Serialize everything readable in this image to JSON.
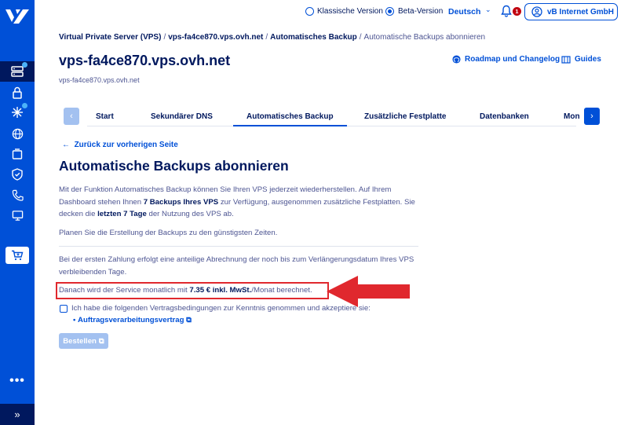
{
  "topbar": {
    "classic_version": "Klassische Version",
    "beta_version": "Beta-Version",
    "language": "Deutsch",
    "notification_count": "1",
    "account_name": "vB Internet GmbH"
  },
  "breadcrumb": [
    "Virtual Private Server (VPS)",
    "vps-fa4ce870.vps.ovh.net",
    "Automatisches Backup",
    "Automatische Backups abonnieren"
  ],
  "header": {
    "title": "vps-fa4ce870.vps.ovh.net",
    "subtitle": "vps-fa4ce870.vps.ovh.net",
    "roadmap_link": "Roadmap und Changelog",
    "guides_link": "Guides"
  },
  "tabs": [
    "Start",
    "Sekundärer DNS",
    "Automatisches Backup",
    "Zusätzliche Festplatte",
    "Datenbanken",
    "Mon"
  ],
  "active_tab": "Automatisches Backup",
  "back_link": "Zurück zur vorherigen Seite",
  "section_title": "Automatische Backups abonnieren",
  "intro": {
    "p1_part1": "Mit der Funktion Automatisches Backup können Sie Ihren VPS jederzeit wiederherstellen. Auf Ihrem Dashboard stehen Ihnen ",
    "p1_bold1": "7 Backups Ihres VPS",
    "p1_part2": " zur Verfügung, ausgenommen zusätzliche Festplatten. Sie decken die ",
    "p1_bold2": "letzten 7 Tage",
    "p1_part3": " der Nutzung des VPS ab.",
    "p2": "Planen Sie die Erstellung der Backups zu den günstigsten Zeiten."
  },
  "billing": {
    "prorata": "Bei der ersten Zahlung erfolgt eine anteilige Abrechnung der noch bis zum Verlängerungsdatum Ihres VPS verbleibenden Tage.",
    "price_prefix": "Danach wird der Service monatlich mit ",
    "price_bold": "7.35 € inkl. MwSt.",
    "price_suffix": "/Monat berechnet."
  },
  "terms": {
    "checkbox_label": "Ich habe die folgenden Vertragsbedingungen zur Kenntnis genommen und akzeptiere sie:",
    "contract_link": "Auftragsverarbeitungsvertrag"
  },
  "order_button": "Bestellen",
  "colors": {
    "sidebar": "#0050d7",
    "sidebar_dark": "#00185e",
    "accent": "#0050d7",
    "highlight": "#e0282e"
  }
}
